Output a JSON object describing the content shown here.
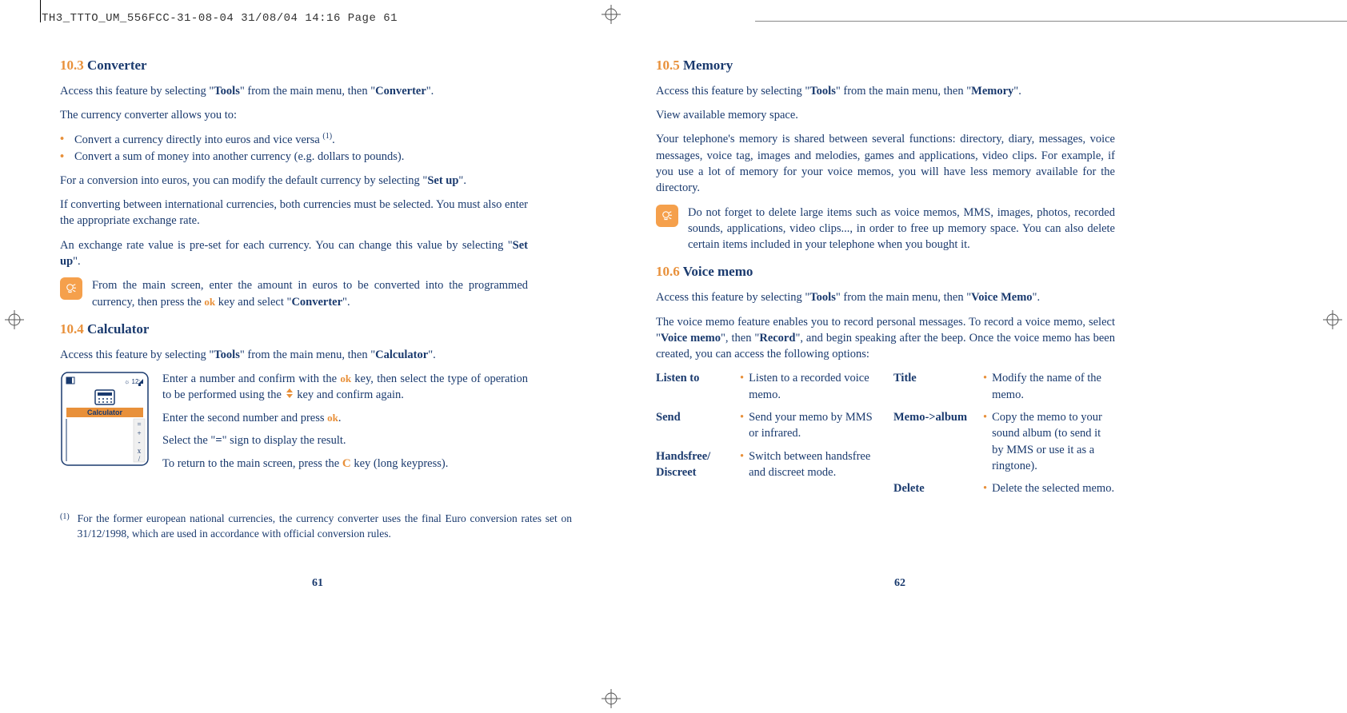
{
  "header": "TH3_TTTO_UM_556FCC-31-08-04  31/08/04  14:16  Page 61",
  "left": {
    "s103": {
      "num": "10.3",
      "title": "Converter",
      "access_pre": "Access this feature by selecting \"",
      "access_tools": "Tools",
      "access_mid": "\" from the main menu, then \"",
      "access_feat": "Converter",
      "access_post": "\".",
      "p1": "The currency converter allows you to:",
      "b1": "Convert a currency directly into euros and vice versa ",
      "b1_sup": "(1)",
      "b1_post": ".",
      "b2": "Convert a sum of money into another currency (e.g. dollars to pounds).",
      "p2_pre": "For a conversion into euros, you can modify the default currency by selecting \"",
      "p2_b": "Set up",
      "p2_post": "\".",
      "p3": "If converting between international currencies, both currencies must be selected. You must also enter the appropriate exchange rate.",
      "p4_pre": "An exchange rate value is pre-set for each currency. You can change this value by selecting \"",
      "p4_b": "Set up",
      "p4_post": "\".",
      "tip_pre": "From the main screen, enter the amount in euros to be converted into the programmed currency, then press the ",
      "tip_mid": " key and select \"",
      "tip_b": "Converter",
      "tip_post": "\"."
    },
    "s104": {
      "num": "10.4",
      "title": "Calculator",
      "access_pre": "Access this feature by selecting \"",
      "access_tools": "Tools",
      "access_mid": "\" from the main menu, then \"",
      "access_feat": "Calculator",
      "access_post": "\".",
      "screen_label": "Calculator",
      "c1_pre": "Enter a number and confirm with the ",
      "c1_mid": " key, then select the type of operation to be performed using the ",
      "c1_post": " key and confirm again.",
      "c2_pre": "Enter the second number and press ",
      "c2_post": ".",
      "c3_pre": "Select the \"",
      "c3_b": "=",
      "c3_post": "\" sign to display the result.",
      "c4_pre": "To return to the main screen, press the ",
      "c4_post": " key (long keypress)."
    },
    "footnote": {
      "marker": "(1)",
      "text": "For the former european national currencies, the currency converter uses the final Euro conversion rates set on 31/12/1998, which are used in accordance with official conversion rules."
    },
    "pagenum": "61"
  },
  "right": {
    "s105": {
      "num": "10.5",
      "title": "Memory",
      "access_pre": "Access this feature by selecting \"",
      "access_tools": "Tools",
      "access_mid": "\" from the main menu, then \"",
      "access_feat": "Memory",
      "access_post": "\".",
      "p1": "View available memory space.",
      "p2": "Your telephone's memory is shared between several functions: directory, diary, messages, voice messages, voice tag, images and melodies, games and applications, video clips. For example, if you use a lot of memory for your voice memos, you will have less memory available for the directory.",
      "tip": "Do not forget to delete large items such as voice memos, MMS, images, photos, recorded sounds, applications, video clips..., in order to free up memory space. You can also delete certain items included in your telephone when you bought it."
    },
    "s106": {
      "num": "10.6",
      "title": "Voice memo",
      "access_pre": "Access this feature by selecting \"",
      "access_tools": "Tools",
      "access_mid": "\" from the main menu, then \"",
      "access_feat": "Voice Memo",
      "access_post": "\".",
      "p1_pre": "The voice memo feature enables you to record personal messages. To record a voice memo, select \"",
      "p1_b1": "Voice memo",
      "p1_mid": "\", then \"",
      "p1_b2": "Record",
      "p1_post": "\", and begin speaking after the beep. Once the voice memo has been created, you can access the following options:",
      "opts_left": [
        {
          "term": "Listen to",
          "def": "Listen to a recorded voice memo."
        },
        {
          "term": "Send",
          "def": "Send your memo by MMS or infrared."
        },
        {
          "term": "Handsfree/ Discreet",
          "def": "Switch between handsfree and discreet mode."
        }
      ],
      "opts_right": [
        {
          "term": "Title",
          "def": "Modify the name of the memo."
        },
        {
          "term": "Memo->album",
          "def": "Copy the memo to your sound album (to send it by MMS or use it as a ringtone)."
        },
        {
          "term": "Delete",
          "def": "Delete the selected memo."
        }
      ]
    },
    "pagenum": "62"
  }
}
